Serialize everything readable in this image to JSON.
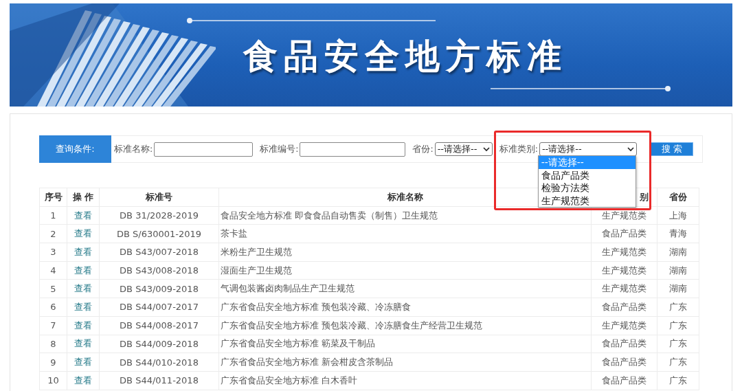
{
  "banner": {
    "title": "食品安全地方标准"
  },
  "query": {
    "label": "查询条件:",
    "fields": [
      {
        "kind": "text",
        "label": "标准名称:"
      },
      {
        "kind": "text",
        "label": "标准编号:"
      },
      {
        "kind": "select",
        "label": "省份:",
        "value": "--请选择--"
      },
      {
        "kind": "select",
        "label": "标准类别:",
        "value": "--请选择--",
        "expanded": true,
        "highlighted": true,
        "options": [
          {
            "label": "--请选择--",
            "selected": true
          },
          {
            "label": "食品产品类",
            "selected": false
          },
          {
            "label": "检验方法类",
            "selected": false
          },
          {
            "label": "生产规范类",
            "selected": false
          }
        ]
      }
    ],
    "search_button": "搜 索"
  },
  "table": {
    "columns": [
      "序号",
      "操 作",
      "标准号",
      "标准名称",
      "别",
      "省份"
    ],
    "rows": [
      [
        "1",
        "查看",
        "DB 31/2028-2019",
        "食品安全地方标准 即食食品自动售卖（制售）卫生规范",
        "生产规范类",
        "上海"
      ],
      [
        "2",
        "查看",
        "DB S/630001-2019",
        "茶卡盐",
        "食品产品类",
        "青海"
      ],
      [
        "3",
        "查看",
        "DB S43/007-2018",
        "米粉生产卫生规范",
        "生产规范类",
        "湖南"
      ],
      [
        "4",
        "查看",
        "DB S43/008-2018",
        "湿面生产卫生规范",
        "生产规范类",
        "湖南"
      ],
      [
        "5",
        "查看",
        "DB S43/009-2018",
        "气调包装酱卤肉制品生产卫生规范",
        "生产规范类",
        "湖南"
      ],
      [
        "6",
        "查看",
        "DB S44/007-2017",
        "广东省食品安全地方标准 预包装冷藏、冷冻膳食",
        "食品产品类",
        "广东"
      ],
      [
        "7",
        "查看",
        "DB S44/008-2017",
        "广东省食品安全地方标准 预包装冷藏、冷冻膳食生产经营卫生规范",
        "生产规范类",
        "广东"
      ],
      [
        "8",
        "查看",
        "DB S44/009-2018",
        "广东省食品安全地方标准 簕菜及干制品",
        "食品产品类",
        "广东"
      ],
      [
        "9",
        "查看",
        "DB S44/010-2018",
        "广东省食品安全地方标准 新会柑皮含茶制品",
        "食品产品类",
        "广东"
      ],
      [
        "10",
        "查看",
        "DB S44/011-2018",
        "广东省食品安全地方标准 白木香叶",
        "食品产品类",
        "广东"
      ]
    ]
  }
}
